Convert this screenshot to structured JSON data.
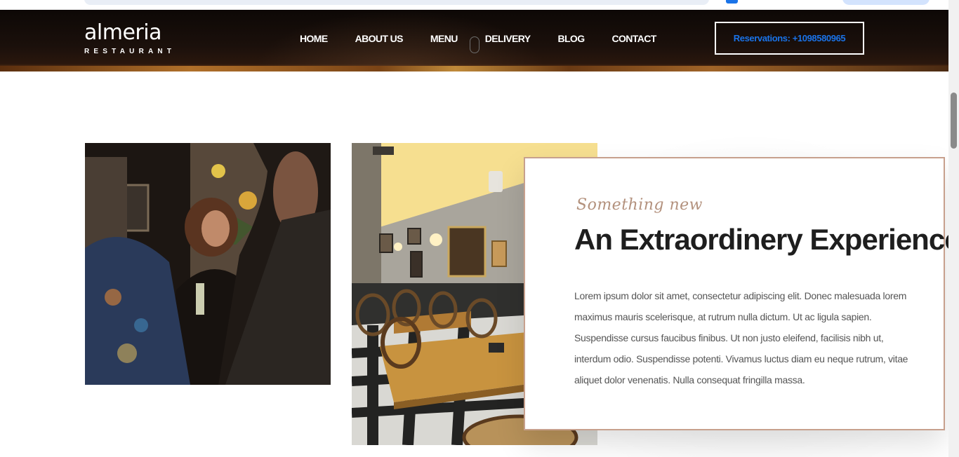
{
  "brand": {
    "name": "almeria",
    "tagline": "RESTAURANT"
  },
  "nav": {
    "items": [
      {
        "label": "HOME"
      },
      {
        "label": "ABOUT US"
      },
      {
        "label": "MENU"
      },
      {
        "label": "DELIVERY"
      },
      {
        "label": "BLOG"
      },
      {
        "label": "CONTACT"
      }
    ]
  },
  "reservation": {
    "label": "Reservations: +1098580965"
  },
  "feature": {
    "kicker": "Something new",
    "title": "An Extraordinery Experience",
    "body": "Lorem ipsum dolor sit amet, consectetur adipiscing elit. Donec malesuada lorem maximus mauris scelerisque, at rutrum nulla dictum. Ut ac ligula sapien. Suspendisse cursus faucibus finibus. Ut non justo eleifend, facilisis nibh ut, interdum odio. Suspendisse potenti. Vivamus luctus diam eu neque rutrum, vitae aliquet dolor venenatis. Nulla consequat fringilla massa."
  },
  "colors": {
    "header_bg": "#0d0806",
    "reservation_text": "#1a73e8",
    "accent_script": "#b3917d",
    "card_border": "#c7a08d"
  },
  "images": [
    {
      "subject": "guests-chatting-with-wine"
    },
    {
      "subject": "restaurant-dining-room-interior"
    }
  ]
}
